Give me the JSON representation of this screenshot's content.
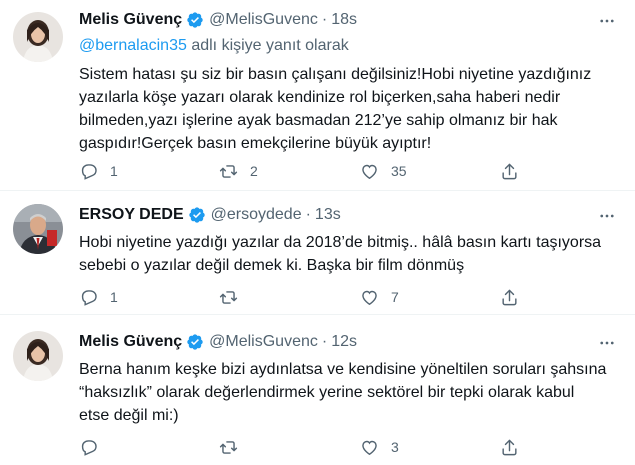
{
  "tweets": [
    {
      "name": "Melis Güvenç",
      "handle": "@MelisGuvenc",
      "separator": "·",
      "time": "18s",
      "reply_to": "@bernalacin35",
      "reply_suffix": " adlı kişiye yanıt olarak",
      "text": "Sistem hatası şu siz bir basın çalışanı değilsiniz!Hobi niyetine yazdığınız\nyazılarla köşe yazarı olarak kendinize rol biçerken,saha haberi nedir\nbilmeden,yazı işlerine ayak basmadan 212’ye sahip olmanız bir hak\ngaspıdır!Gerçek basın emekçilerine büyük ayıptır!",
      "replies": "1",
      "retweets": "2",
      "likes": "35"
    },
    {
      "name": "ERSOY DEDE",
      "handle": "@ersoydede",
      "separator": "·",
      "time": "13s",
      "text": "Hobi niyetine yazdığı yazılar da 2018’de bitmiş.. hâlâ basın kartı taşıyorsa\nsebebi o yazılar değil demek ki. Başka bir film dönmüş",
      "replies": "1",
      "retweets": "",
      "likes": "7"
    },
    {
      "name": "Melis Güvenç",
      "handle": "@MelisGuvenc",
      "separator": "·",
      "time": "12s",
      "text": "Berna hanım keşke bizi aydınlatsa ve kendisine yöneltilen soruları şahsına\n“haksızlık” olarak değerlendirmek yerine sektörel bir tepki olarak kabul\netse değil mi:)",
      "replies": "",
      "retweets": "",
      "likes": "3"
    }
  ],
  "icons": {
    "verified": "verified-badge-icon",
    "more": "more-options-icon",
    "reply": "reply-icon",
    "retweet": "retweet-icon",
    "like": "like-icon",
    "share": "share-icon"
  },
  "colors": {
    "accent": "#1d9bf0",
    "secondary_text": "#536471",
    "primary_text": "#0f1419"
  }
}
